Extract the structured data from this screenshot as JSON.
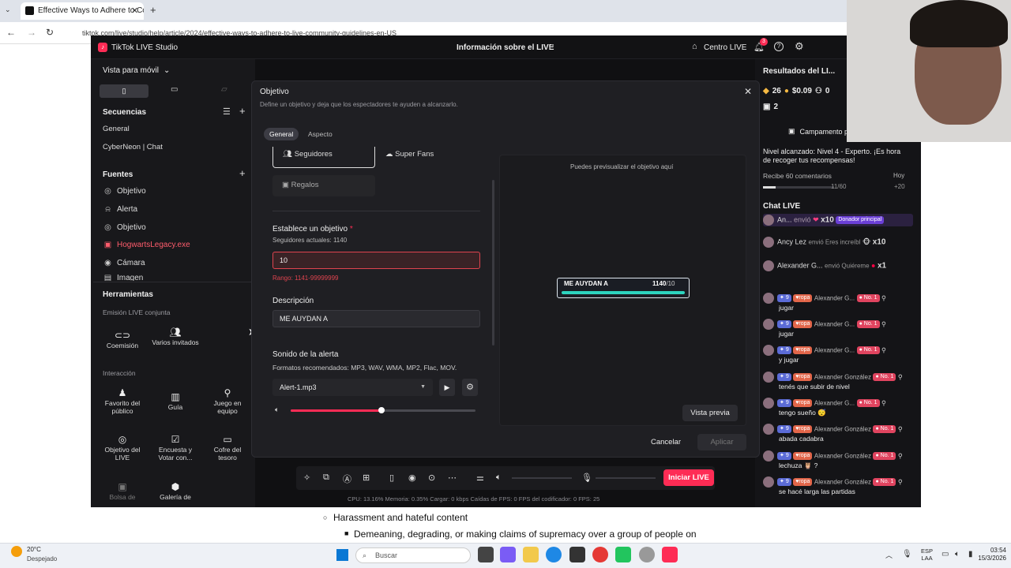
{
  "browser": {
    "tab_title": "Effective Ways to Adhere to Co",
    "url": "tiktok.com/live/studio/help/article/2024/effective-ways-to-adhere-to-live-community-guidelines-en-US"
  },
  "studio": {
    "app_title": "TikTok LIVE Studio",
    "center_title": "Información sobre el LIVE",
    "live_center": "Centro LIVE",
    "notif_count": "3"
  },
  "left": {
    "view_label": "Vista para móvil",
    "sequences_title": "Secuencias",
    "sequences": [
      "General",
      "CyberNeon | Chat"
    ],
    "sources_title": "Fuentes",
    "sources": [
      {
        "label": "Objetivo",
        "icon": "target-icon",
        "color": "#e8e8e8"
      },
      {
        "label": "Alerta",
        "icon": "bell-icon",
        "color": "#e8e8e8"
      },
      {
        "label": "Objetivo",
        "icon": "target-icon",
        "color": "#e8e8e8"
      },
      {
        "label": "HogwartsLegacy.exe",
        "icon": "window-icon",
        "color": "#ff5c6c"
      },
      {
        "label": "Cámara",
        "icon": "camera-icon",
        "color": "#e8e8e8"
      },
      {
        "label": "Imagen",
        "icon": "image-icon",
        "color": "#e8e8e8"
      }
    ],
    "tools_title": "Herramientas",
    "joint_title": "Emisión LIVE conjunta",
    "joint_tools": [
      "Coemisión",
      "Varios invitados"
    ],
    "interaction_title": "Interacción",
    "interaction_tools": [
      "Favorito del público",
      "Guía",
      "Juego en equipo",
      "Objetivo del LIVE",
      "Encuesta y Votar con...",
      "Cofre del tesoro",
      "Bolsa de",
      "Galería de"
    ]
  },
  "dialog": {
    "title": "Objetivo",
    "subtitle": "Define un objetivo y deja que los espectadores te ayuden a alcanzarlo.",
    "tabs": [
      "General",
      "Aspecto"
    ],
    "goal_types": [
      "Seguidores",
      "Super Fans",
      "Regalos"
    ],
    "set_goal_label": "Establece un objetivo",
    "current_followers": "Seguidores actuales: 1140",
    "goal_value": "10",
    "range_hint": "Rango: 1141-99999999",
    "description_label": "Descripción",
    "description_value": "ME AUYDAN A",
    "sound_label": "Sonido de la alerta",
    "formats_hint": "Formatos recomendados: MP3, WAV, WMA, MP2, Flac, MOV.",
    "sound_file": "Alert-1.mp3",
    "volume": 0.49,
    "preview_hint": "Puedes previsualizar el objetivo aquí",
    "preview_label": "ME AUYDAN A",
    "preview_count": "1140",
    "preview_goal": "/10",
    "preview_button": "Vista previa",
    "cancel": "Cancelar",
    "apply": "Aplicar"
  },
  "right": {
    "results_title": "Resultados del LI...",
    "stats": [
      "26",
      "$0.09",
      "0",
      "2"
    ],
    "campaign": "Campamento p",
    "level_text": "Nivel alcanzado: Nivel 4 - Experto. ¡Es hora de recoger tus recompensas!",
    "task_text": "Recibe 60 comentarios",
    "task_when": "Hoy",
    "task_progress": "11/60",
    "task_reward": "+20",
    "chat_title": "Chat LIVE",
    "gifts": [
      {
        "name": "An...",
        "text": "envió",
        "count": "x10",
        "tag": "Donador principal"
      },
      {
        "name": "Ancy Lez",
        "text": "envió Eres increíbl",
        "count": "x10",
        "tag": ""
      },
      {
        "name": "Alexander G...",
        "text": "envió Quiéreme",
        "count": "x1",
        "tag": ""
      }
    ],
    "messages": [
      {
        "name": "Alexander G...",
        "text": "jugar"
      },
      {
        "name": "Alexander G...",
        "text": "jugar"
      },
      {
        "name": "Alexander G...",
        "text": "y jugar"
      },
      {
        "name": "Alexander González",
        "text": "tenés que subir de nivel"
      },
      {
        "name": "Alexander G...",
        "text": "tengo sueño 😴"
      },
      {
        "name": "Alexander González",
        "text": "abada cadabra"
      },
      {
        "name": "Alexander González",
        "text": "lechuza 🦉 ?"
      },
      {
        "name": "Alexander González",
        "text": "se hacé larga las partidas"
      }
    ],
    "badge_level": "9",
    "badge_rank": "No. 1",
    "badge_fan": "ropa"
  },
  "bottom": {
    "go_live": "Iniciar LIVE",
    "status": "CPU: 13.16%     Memoria: 0.35%     Cargar: 0 kbps     Caídas de FPS: 0     FPS del codificador: 0     FPS: 25"
  },
  "page_text": {
    "line1": "Harassment and hateful content",
    "line2": "Demeaning, degrading, or making claims of supremacy over a group of people on"
  },
  "taskbar": {
    "temp": "20°C",
    "weather": "Despejado",
    "search": "Buscar",
    "lang": "ESP",
    "lang2": "LAA",
    "time": "03:54",
    "date": "15/3/2026"
  },
  "colors": {
    "accent": "#fe2c55",
    "teal": "#2dd4bf",
    "bg": "#1f1f23"
  }
}
